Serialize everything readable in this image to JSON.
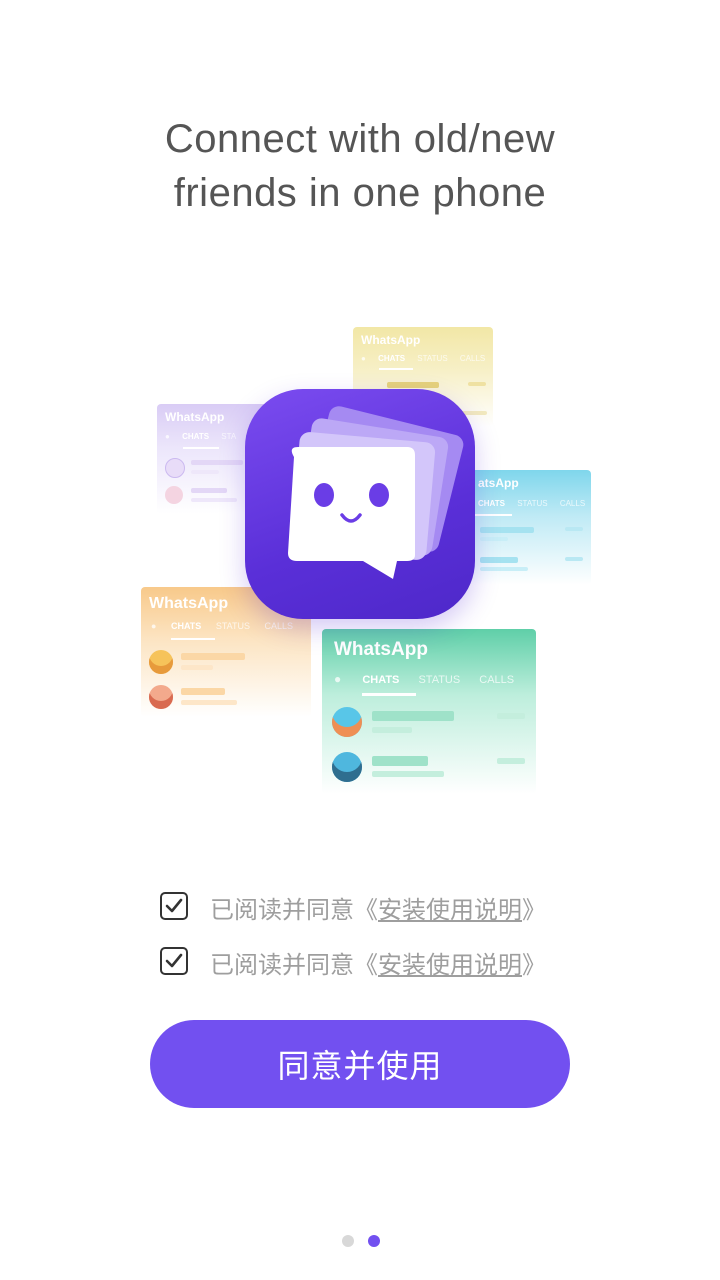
{
  "headline": {
    "line1": "Connect with old/new",
    "line2": "friends in one phone"
  },
  "cards": {
    "app_name": "WhatsApp",
    "app_name_partial": "atsApp",
    "tab_chats": "CHATS",
    "tab_status": "STATUS",
    "tab_status_partial": "STA",
    "tab_calls": "CALLS",
    "tab_calls_partial": "CALLS"
  },
  "agreements": [
    {
      "prefix": "已阅读并同意《",
      "link": "安装使用说明",
      "suffix": "》",
      "checked": true
    },
    {
      "prefix": "已阅读并同意《",
      "link": "安装使用说明",
      "suffix": "》",
      "checked": true
    }
  ],
  "cta_label": "同意并使用",
  "pager": {
    "total": 2,
    "active": 2
  },
  "colors": {
    "accent": "#7250f0",
    "green_card": "#5fcfa8",
    "orange_card": "#f8c98a",
    "purple_card": "#d9ccf5",
    "yellow_card": "#f2e7a6",
    "blue_card": "#7fd6ec"
  }
}
